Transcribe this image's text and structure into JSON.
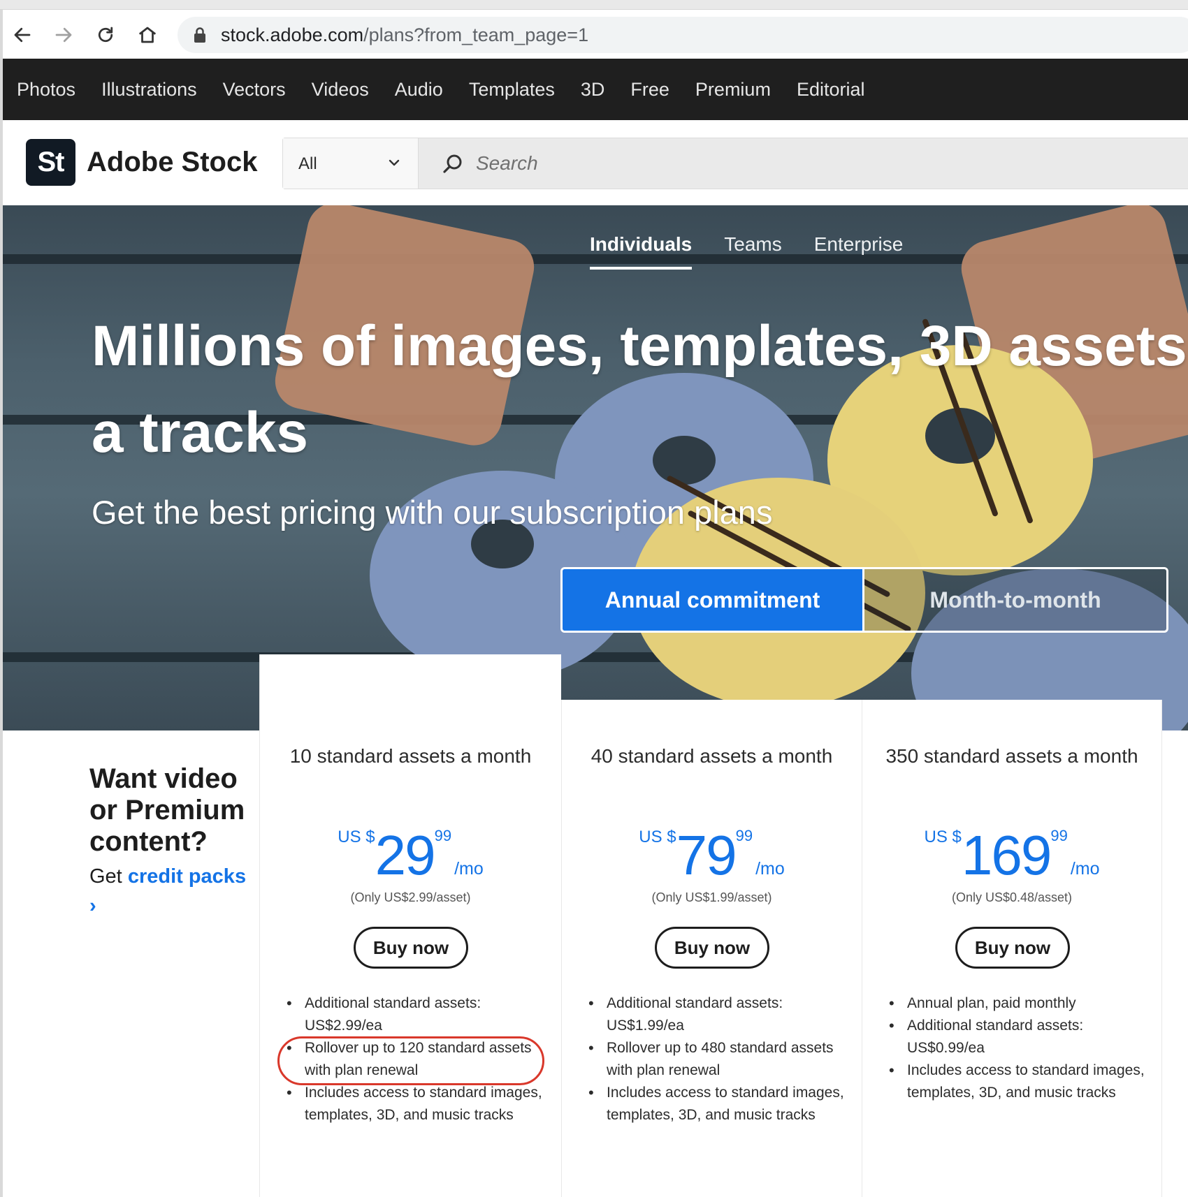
{
  "browser": {
    "url_host": "stock.adobe.com",
    "url_path": "/plans?from_team_page=1"
  },
  "catnav": [
    "Photos",
    "Illustrations",
    "Vectors",
    "Videos",
    "Audio",
    "Templates",
    "3D",
    "Free",
    "Premium",
    "Editorial"
  ],
  "header": {
    "logo_mark": "St",
    "logo_text": "Adobe Stock",
    "search_scope": "All",
    "search_placeholder": "Search"
  },
  "hero": {
    "tabs": [
      "Individuals",
      "Teams",
      "Enterprise"
    ],
    "active_tab": "Individuals",
    "title": "Millions of images, templates, 3D assets a tracks",
    "subtitle": "Get the best pricing with our subscription plans",
    "billing_options": [
      "Annual commitment",
      "Month-to-month"
    ],
    "active_billing": "Annual commitment"
  },
  "promo": {
    "heading": "Want video or Premium content?",
    "prefix": "Get ",
    "link": "credit packs ›"
  },
  "plans": [
    {
      "name": "10 standard assets a month",
      "currency": "US $",
      "amount": "29",
      "cents": "99",
      "period": "/mo",
      "per_asset": "(Only US$2.99/asset)",
      "cta": "Buy now",
      "features": [
        "Additional standard assets: US$2.99/ea",
        "Rollover up to 120 standard assets with plan renewal",
        "Includes access to standard images, templates, 3D, and music tracks"
      ]
    },
    {
      "name": "40 standard assets a month",
      "currency": "US $",
      "amount": "79",
      "cents": "99",
      "period": "/mo",
      "per_asset": "(Only US$1.99/asset)",
      "cta": "Buy now",
      "features": [
        "Additional standard assets: US$1.99/ea",
        "Rollover up to 480 standard assets with plan renewal",
        "Includes access to standard images, templates, 3D, and music tracks"
      ]
    },
    {
      "name": "350 standard assets a month",
      "currency": "US $",
      "amount": "169",
      "cents": "99",
      "period": "/mo",
      "per_asset": "(Only US$0.48/asset)",
      "cta": "Buy now",
      "features": [
        "Annual plan, paid monthly",
        "Additional standard assets: US$0.99/ea",
        "Includes access to standard images, templates, 3D, and music tracks"
      ]
    }
  ],
  "colors": {
    "accent": "#1473e6",
    "nav_bg": "#1f1f1f",
    "highlight": "#d9382b"
  }
}
